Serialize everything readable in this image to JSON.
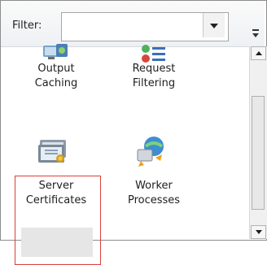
{
  "filter": {
    "label": "Filter:",
    "value": "",
    "placeholder": "",
    "dropdown_icon": "chevron-down-icon",
    "overflow_icon": "toolbar-overflow-icon"
  },
  "features": [
    {
      "label_line1": "Output",
      "label_line2": "Caching",
      "icon": "output-caching-icon"
    },
    {
      "label_line1": "Request",
      "label_line2": "Filtering",
      "icon": "request-filtering-icon"
    },
    {
      "label_line1": "Server",
      "label_line2": "Certificates",
      "icon": "server-certificates-icon",
      "selected": true
    },
    {
      "label_line1": "Worker",
      "label_line2": "Processes",
      "icon": "worker-processes-icon"
    }
  ],
  "colors": {
    "selection_border": "#d9413a",
    "selection_fill": "#e6e6e6"
  }
}
